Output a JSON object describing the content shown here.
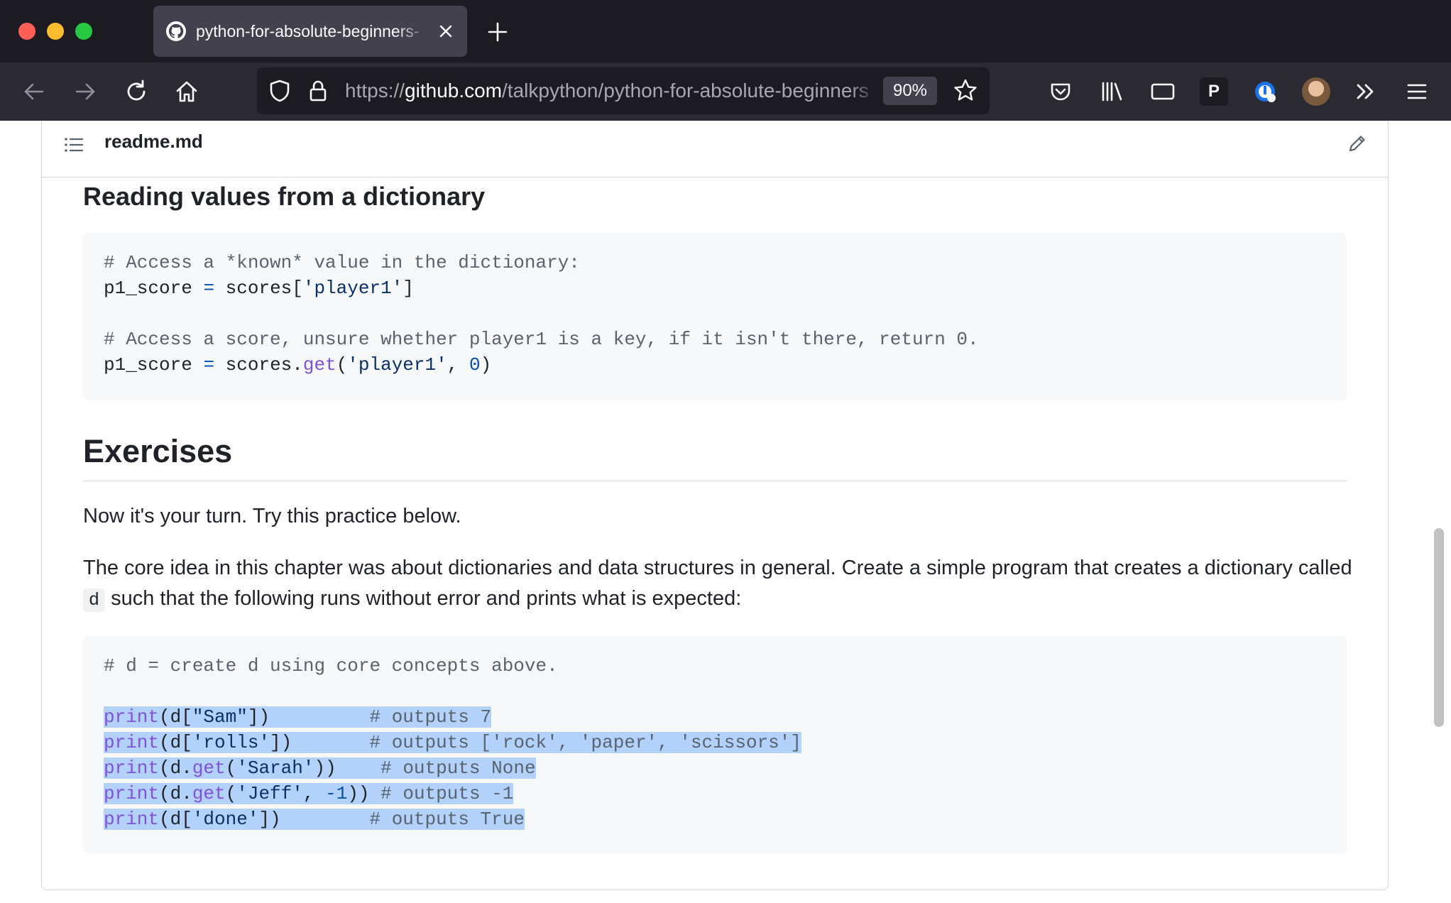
{
  "browser": {
    "tab_title": "python-for-absolute-beginners-",
    "url_scheme": "https://",
    "url_host": "github.com",
    "url_path": "/talkpython/python-for-absolute-beginners",
    "zoom": "90%",
    "profile_letter": "P"
  },
  "readme": {
    "file_name": "readme.md",
    "section1_heading": "Reading values from a dictionary",
    "code1": {
      "line1_comment": "# Access a *known* value in the dictionary:",
      "line2_var": "p1_score",
      "line2_eq": "=",
      "line2_obj": "scores[",
      "line2_str": "'player1'",
      "line2_end": "]",
      "line4_comment": "# Access a score, unsure whether player1 is a key, if it isn't there, return 0.",
      "line5_var": "p1_score",
      "line5_eq": "=",
      "line5_obj": "scores.",
      "line5_fn": "get",
      "line5_open": "(",
      "line5_str": "'player1'",
      "line5_comma": ", ",
      "line5_num": "0",
      "line5_close": ")"
    },
    "exercises_heading": "Exercises",
    "para1": "Now it's your turn. Try this practice below.",
    "para2_before": "The core idea in this chapter was about dictionaries and data structures in general. Create a simple program that creates a dictionary called",
    "para2_code": "d",
    "para2_after": "such that the following runs without error and prints what is expected:",
    "code2": {
      "comment_line": "# d = create d using core concepts above.",
      "l1_fn": "print",
      "l1_a": "(d[",
      "l1_str": "\"Sam\"",
      "l1_b": "])",
      "l1_pad": "         ",
      "l1_com": "# outputs 7",
      "l2_fn": "print",
      "l2_a": "(d[",
      "l2_str": "'rolls'",
      "l2_b": "])",
      "l2_pad": "       ",
      "l2_com": "# outputs ['rock', 'paper', 'scissors']",
      "l3_fn": "print",
      "l3_a": "(d.",
      "l3_get": "get",
      "l3_b": "(",
      "l3_str": "'Sarah'",
      "l3_c": "))",
      "l3_pad": "    ",
      "l3_com": "# outputs None",
      "l4_fn": "print",
      "l4_a": "(d.",
      "l4_get": "get",
      "l4_b": "(",
      "l4_str": "'Jeff'",
      "l4_c": ", ",
      "l4_num": "-1",
      "l4_d": "))",
      "l4_pad": " ",
      "l4_com": "# outputs -1",
      "l5_fn": "print",
      "l5_a": "(d[",
      "l5_str": "'done'",
      "l5_b": "])",
      "l5_pad": "        ",
      "l5_com": "# outputs True"
    }
  }
}
